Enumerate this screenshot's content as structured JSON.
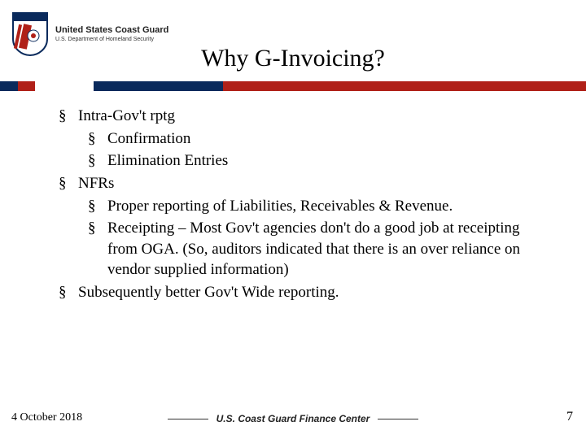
{
  "header": {
    "org_title": "United States Coast Guard",
    "org_sub": "U.S. Department of Homeland Security",
    "slide_title": "Why G-Invoicing?"
  },
  "bullets": {
    "b1": "Intra-Gov't rptg",
    "b1a": "Confirmation",
    "b1b": "Elimination Entries",
    "b2": "NFRs",
    "b2a": "Proper reporting of Liabilities, Receivables & Revenue.",
    "b2b": "Receipting – Most Gov't agencies don't do a good job at receipting from OGA. (So, auditors indicated that there is an over reliance on vendor supplied information)",
    "b3": "Subsequently better Gov't Wide reporting."
  },
  "footer": {
    "date": "4 October 2018",
    "center": "U.S. Coast Guard Finance Center",
    "page": "7"
  }
}
